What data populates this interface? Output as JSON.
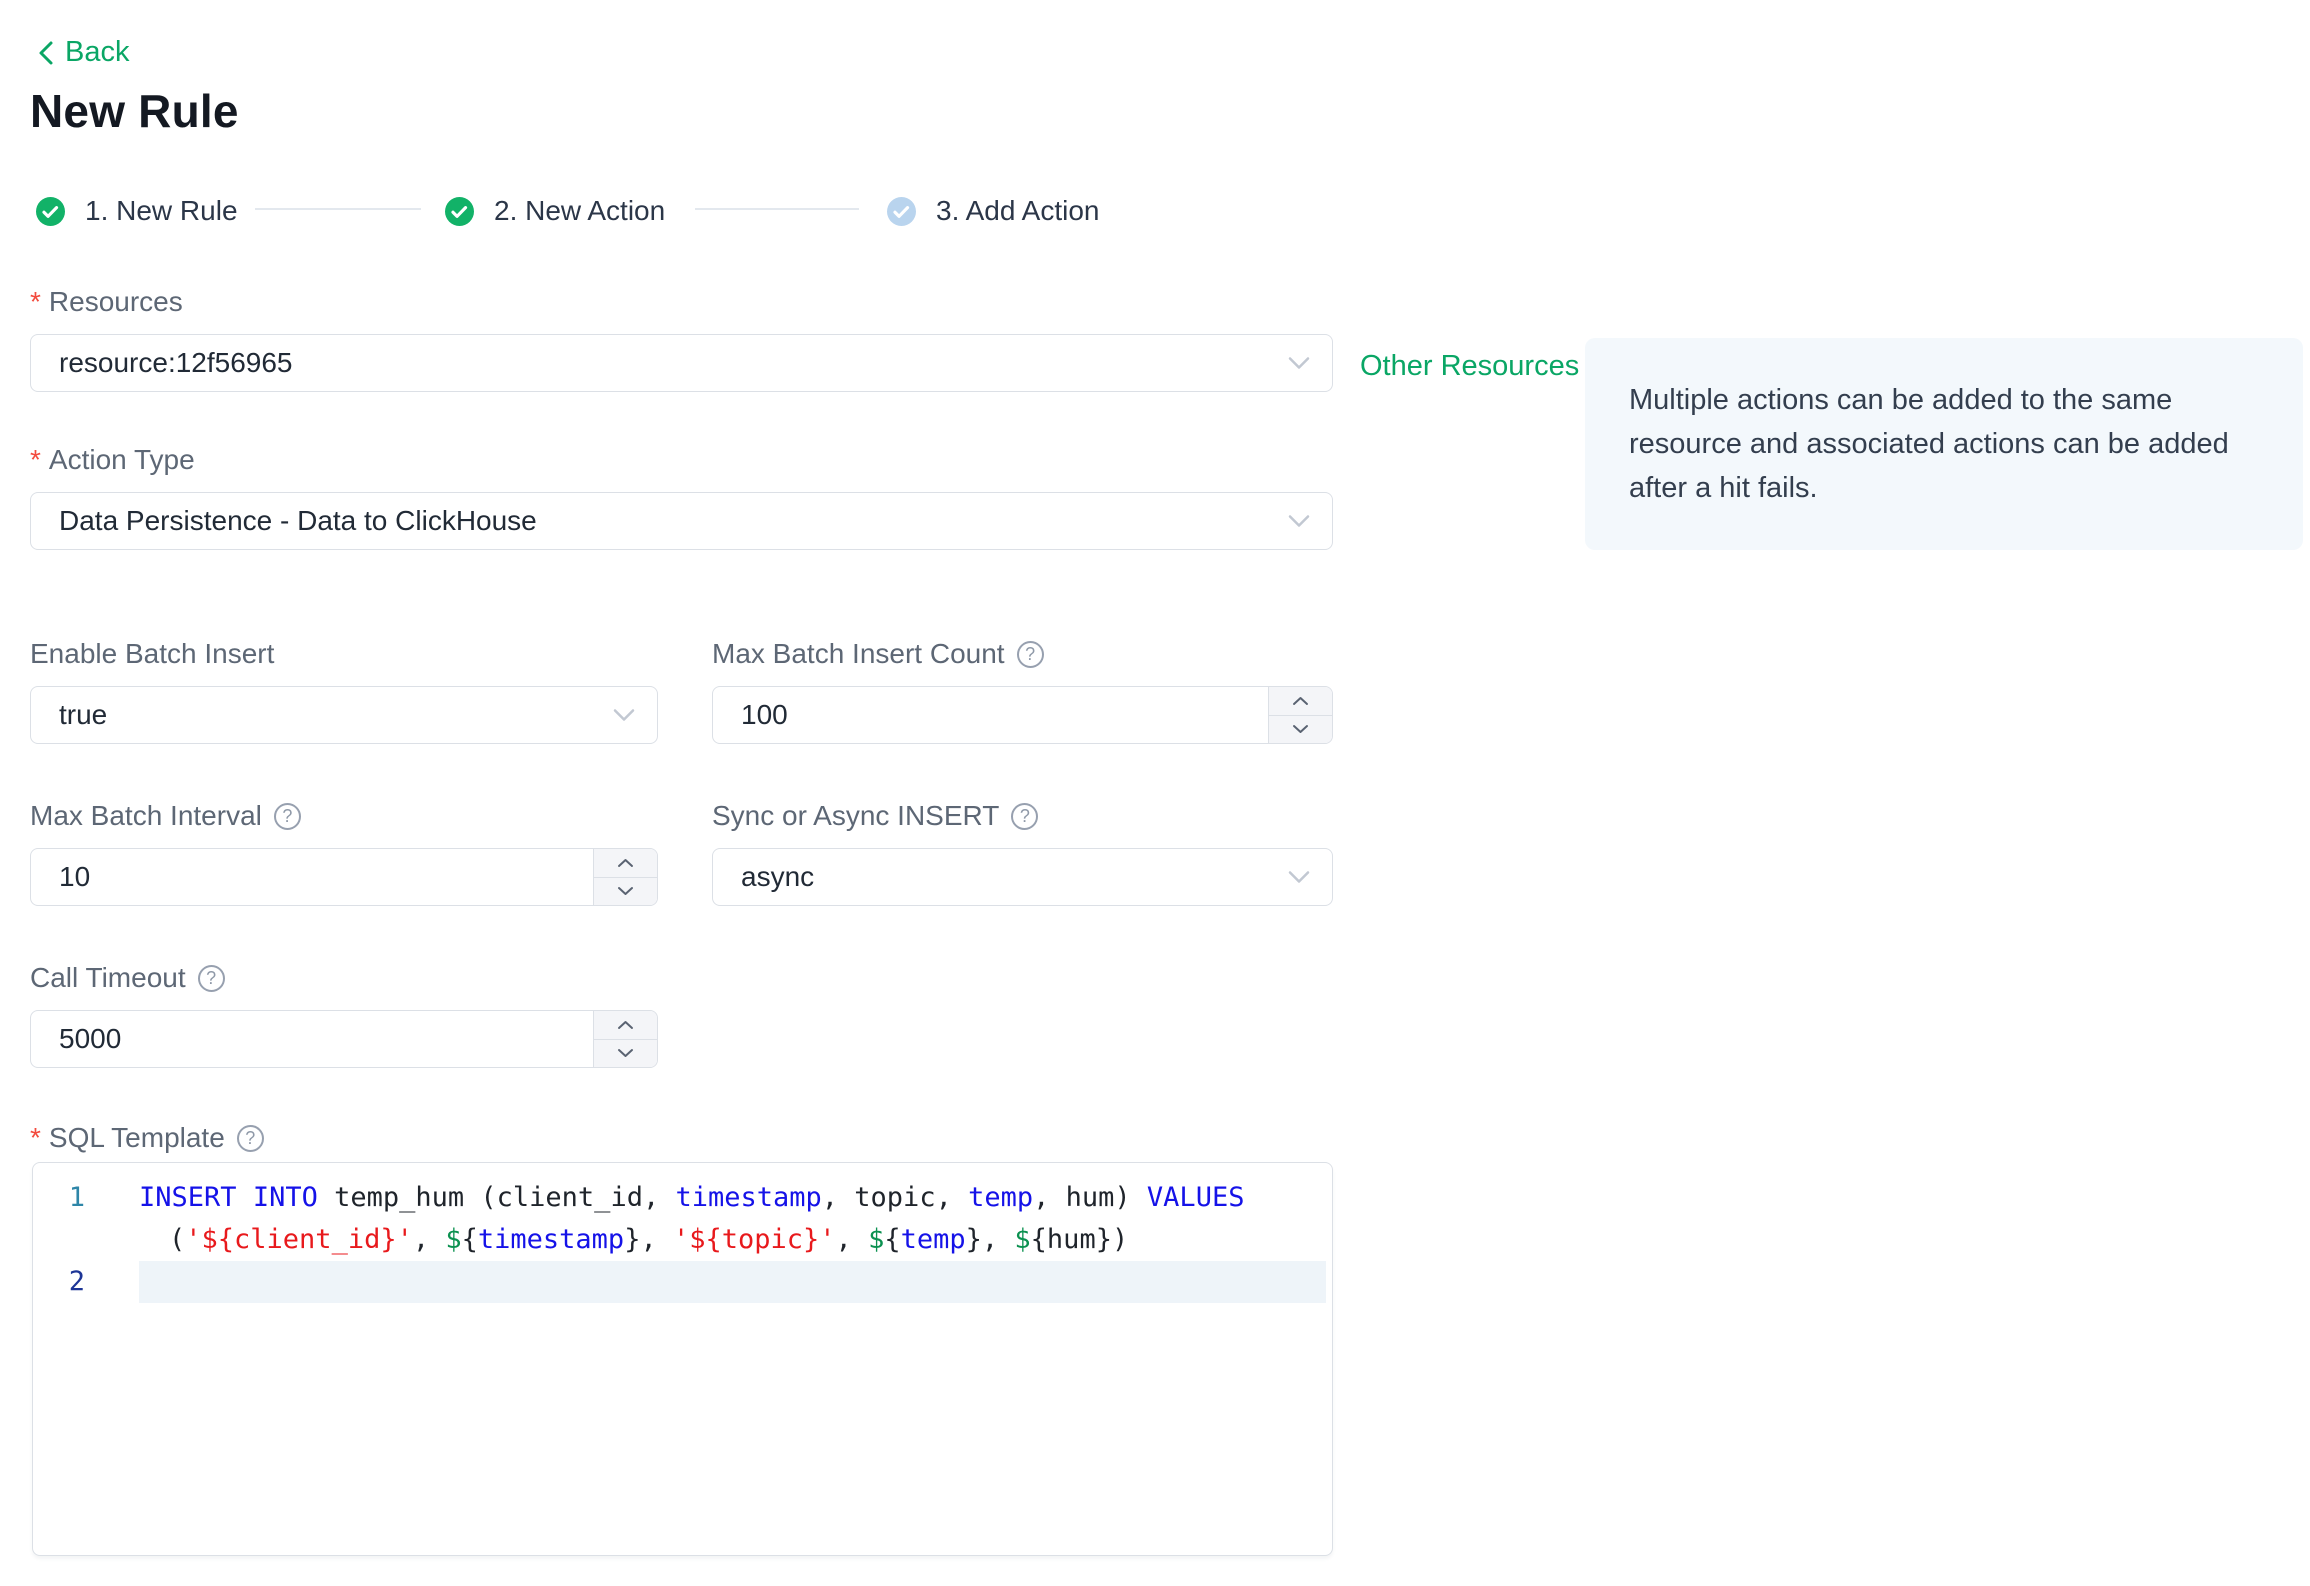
{
  "ui": {
    "back_label": "Back",
    "page_title": "New Rule",
    "required_mark": "*",
    "help_glyph": "?"
  },
  "colors": {
    "accent_green": "#0aa665",
    "step_done_green": "#12b268",
    "step_pending_blue": "#b9d4ee",
    "info_box_bg": "#f3f8fc",
    "field_border": "#dce0e6",
    "label_gray": "#5d6775",
    "required_red": "#f34b3e",
    "code_keyword": "#1512e8",
    "code_string": "#e8191c",
    "code_variable": "#0b9150",
    "code_text": "#1f242b",
    "line_number_1": "#2e86a8",
    "line_number_active": "#1d3596",
    "active_line_bg": "#eef4f9"
  },
  "stepper": {
    "steps": [
      {
        "label": "1. New Rule",
        "state": "done"
      },
      {
        "label": "2. New Action",
        "state": "done"
      },
      {
        "label": "3. Add Action",
        "state": "pending"
      }
    ]
  },
  "form": {
    "resources": {
      "label": "Resources",
      "value": "resource:12f56965"
    },
    "other_resources_link": "Other Resources",
    "info_tip": "Multiple actions can be added to the same resource and associated actions can be added after a hit fails.",
    "action_type": {
      "label": "Action Type",
      "value": "Data Persistence - Data to ClickHouse"
    },
    "enable_batch_insert": {
      "label": "Enable Batch Insert",
      "value": "true"
    },
    "max_batch_insert_count": {
      "label": "Max Batch Insert Count",
      "value": "100"
    },
    "max_batch_interval": {
      "label": "Max Batch Interval",
      "value": "10"
    },
    "sync_or_async_insert": {
      "label": "Sync or Async INSERT",
      "value": "async"
    },
    "call_timeout": {
      "label": "Call Timeout",
      "value": "5000"
    },
    "sql_template": {
      "label": "SQL Template"
    }
  },
  "sql_editor": {
    "rows": [
      {
        "line_no": "1",
        "tokens": [
          [
            "kw",
            "INSERT"
          ],
          [
            "pl",
            " "
          ],
          [
            "kw",
            "INTO"
          ],
          [
            "pl",
            " temp_hum (client_id, "
          ],
          [
            "kw",
            "timestamp"
          ],
          [
            "pl",
            ", topic, "
          ],
          [
            "kw",
            "temp"
          ],
          [
            "pl",
            ", hum) "
          ],
          [
            "kw",
            "VALUES"
          ]
        ]
      },
      {
        "line_no": "",
        "tokens": [
          [
            "pl",
            "("
          ],
          [
            "str",
            "'${client_id}'"
          ],
          [
            "pl",
            ", "
          ],
          [
            "var",
            "$"
          ],
          [
            "pl",
            "{"
          ],
          [
            "kw",
            "timestamp"
          ],
          [
            "pl",
            "}, "
          ],
          [
            "str",
            "'${topic}'"
          ],
          [
            "pl",
            ", "
          ],
          [
            "var",
            "$"
          ],
          [
            "pl",
            "{"
          ],
          [
            "kw",
            "temp"
          ],
          [
            "pl",
            "}, "
          ],
          [
            "var",
            "$"
          ],
          [
            "pl",
            "{hum})"
          ]
        ]
      },
      {
        "line_no": "2",
        "tokens": []
      }
    ]
  }
}
